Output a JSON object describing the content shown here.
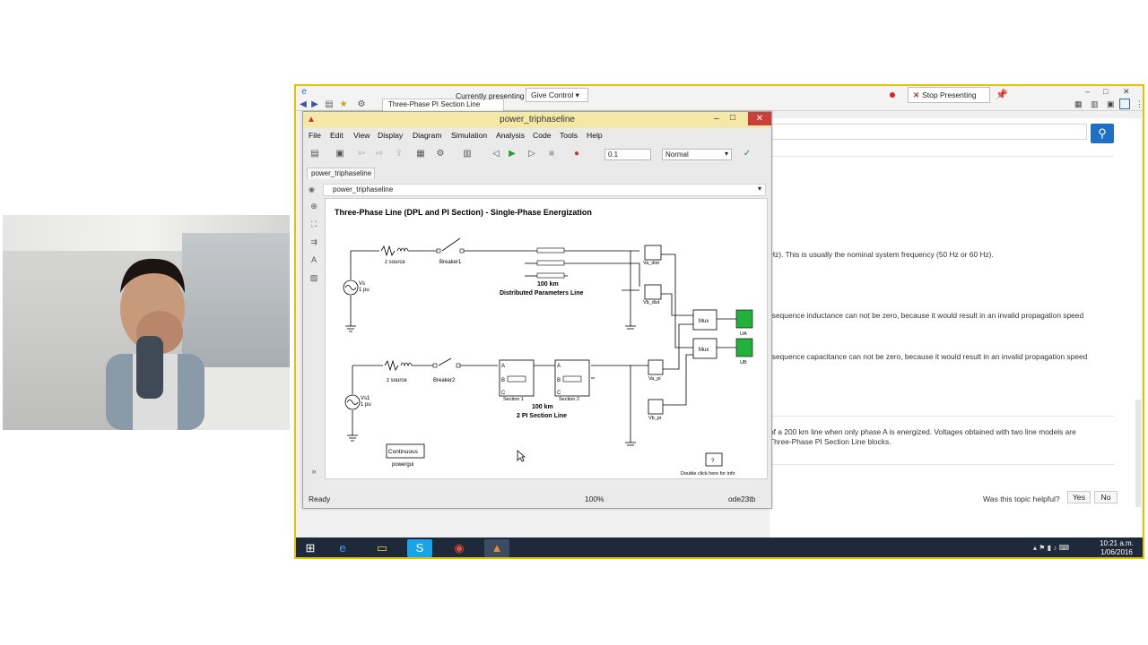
{
  "browser": {
    "tab_title": "Three-Phase PI Section Line",
    "presenting_label": "Currently presenting",
    "give_control": "Give Control",
    "stop_presenting": "Stop Presenting"
  },
  "simulink": {
    "window_title": "power_triphaseline",
    "menu": [
      "File",
      "Edit",
      "View",
      "Display",
      "Diagram",
      "Simulation",
      "Analysis",
      "Code",
      "Tools",
      "Help"
    ],
    "stop_time": "0.1",
    "sim_mode": "Normal",
    "model_tab": "power_triphaseline",
    "breadcrumb": "power_triphaseline",
    "status": {
      "state": "Ready",
      "zoom": "100%",
      "solver": "ode23tb"
    },
    "diagram": {
      "title": "Three-Phase Line (DPL and PI Section) - Single-Phase Energization",
      "vs_label": "Vs",
      "vs_value": "1 pu",
      "vs1_label": "Vs1",
      "vs1_value": "1 pu",
      "zsource": "z source",
      "breaker1": "Breaker1",
      "breaker2": "Breaker2",
      "dpl_len": "100 km",
      "dpl_name": "Distributed Parameters Line",
      "pi_len": "100 km",
      "pi_name": "2 PI Section Line",
      "section1": "Section 1",
      "section2": "Section 2",
      "va_dist": "Va_dist",
      "vb_dist": "Vb_dist",
      "va_pi": "Va_pi",
      "vb_pi": "Vb_pi",
      "mux": "Mux",
      "ua": "UA",
      "ub": "UB",
      "powergui_block": "Continuous",
      "powergui": "powergui",
      "info_block": "?",
      "info": "Double click here for info"
    }
  },
  "help": {
    "p1": "Hz). This is usually the nominal system frequency (50 Hz or 60 Hz).",
    "p2": "-sequence inductance can not be zero, because it would result in an invalid propagation speed",
    "p3": "-sequence capacitance can not be zero, because it would result in an invalid propagation speed",
    "p4a": "of a 200 km line when only phase A is energized. Voltages obtained with two line models are",
    "p4b": "Three-Phase PI Section Line blocks.",
    "helpful": "Was this topic helpful?",
    "yes": "Yes",
    "no": "No"
  },
  "taskbar": {
    "time": "10:21 a.m.",
    "date": "1/06/2016"
  }
}
